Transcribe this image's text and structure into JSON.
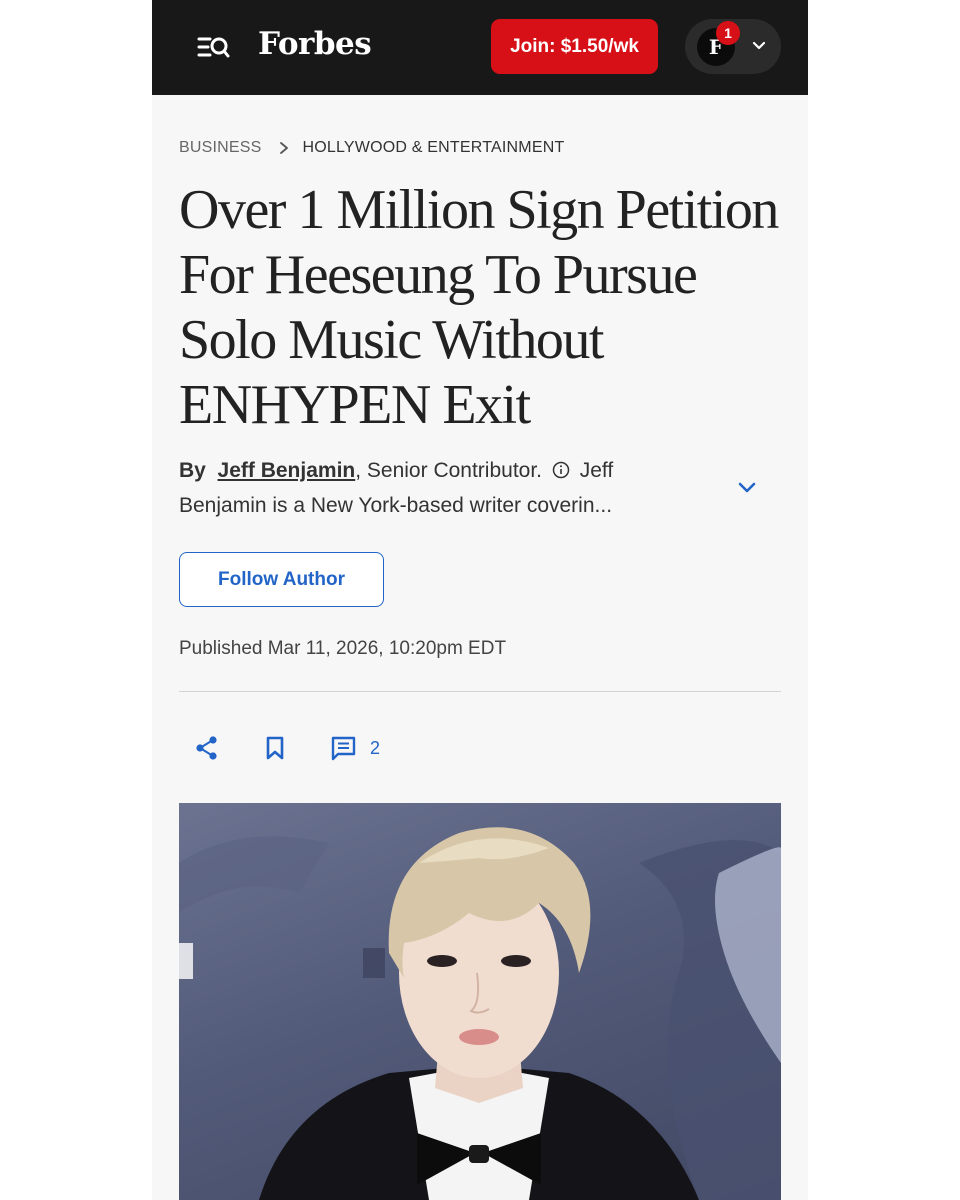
{
  "header": {
    "logo": "Forbes",
    "join_label": "Join: $1.50/wk",
    "avatar_initial": "F",
    "notification_count": "1"
  },
  "breadcrumb": {
    "section": "BUSINESS",
    "subsection": "HOLLYWOOD & ENTERTAINMENT"
  },
  "article": {
    "headline": "Over 1 Million Sign Petition For Heeseung To Pursue Solo Music Without ENHYPEN Exit",
    "byline_prefix": "By",
    "author": "Jeff Benjamin",
    "author_role": ", Senior Contributor.",
    "author_bio": "Jeff Benjamin is a New York-based writer coverin...",
    "follow_label": "Follow Author",
    "published": "Published Mar 11, 2026, 10:20pm EDT",
    "comment_count": "2"
  },
  "colors": {
    "header_bg": "#181818",
    "join_red": "#d70f17",
    "link_blue": "#2264c7"
  },
  "icons": [
    "menu-search-icon",
    "chevron-down-icon",
    "chevron-right-icon",
    "info-icon",
    "share-icon",
    "bookmark-icon",
    "comment-icon"
  ]
}
